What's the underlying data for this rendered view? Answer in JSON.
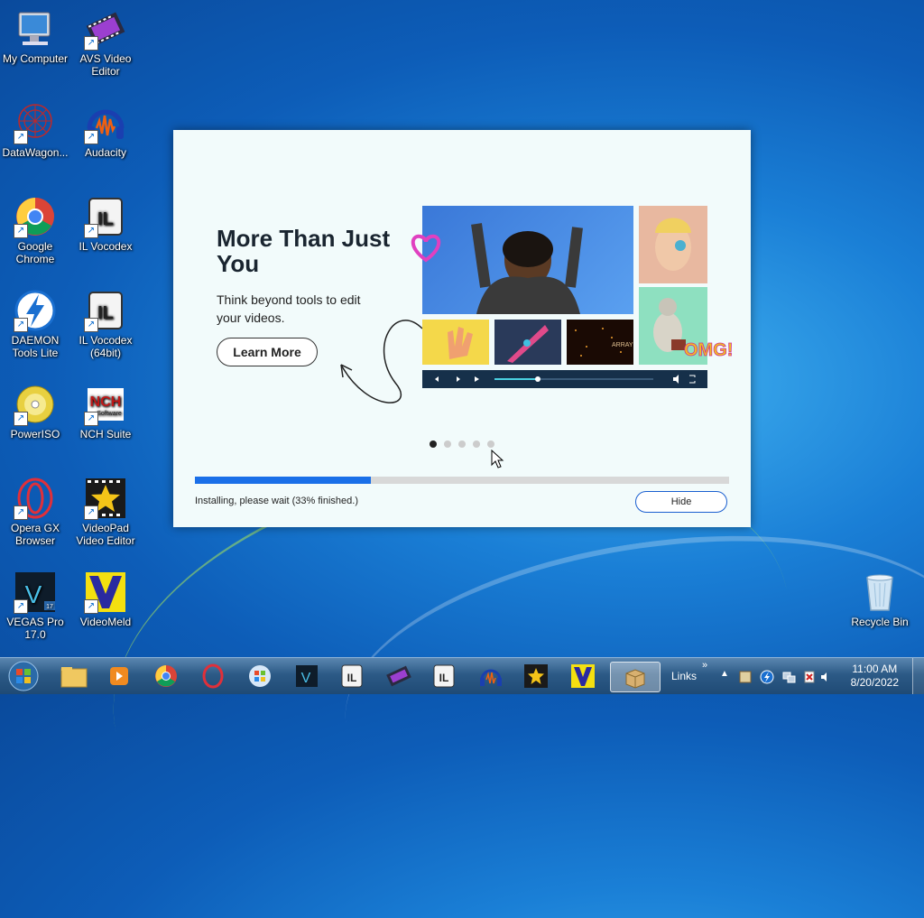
{
  "desktop": {
    "icons": [
      {
        "label": "My Computer"
      },
      {
        "label": "AVS Video Editor"
      },
      {
        "label": "DataWagon..."
      },
      {
        "label": "Audacity"
      },
      {
        "label": "Google Chrome"
      },
      {
        "label": "IL Vocodex"
      },
      {
        "label": "DAEMON Tools Lite"
      },
      {
        "label": "IL Vocodex (64bit)"
      },
      {
        "label": "PowerISO"
      },
      {
        "label": "NCH Suite"
      },
      {
        "label": "Opera GX Browser"
      },
      {
        "label": "VideoPad Video Editor"
      },
      {
        "label": "VEGAS Pro 17.0"
      },
      {
        "label": "VideoMeld"
      },
      {
        "label": "Recycle Bin"
      }
    ],
    "ncj_logo": "NCH",
    "ncj_sub": "Software",
    "vegas_letter": "V",
    "vegas_version": "17",
    "il_text": "IL"
  },
  "installer": {
    "headline": "More Than Just You",
    "subtitle": "Think beyond tools to edit your videos.",
    "learn_more": "Learn More",
    "collage_caption": "ARRAY",
    "omg_text": "OMG!",
    "carousel_total": 5,
    "carousel_active": 1,
    "progress_fraction": 0.33,
    "status": "Installing, please wait (33% finished.)",
    "hide_label": "Hide"
  },
  "taskbar": {
    "links_label": "Links",
    "time": "11:00 AM",
    "date": "8/20/2022"
  }
}
